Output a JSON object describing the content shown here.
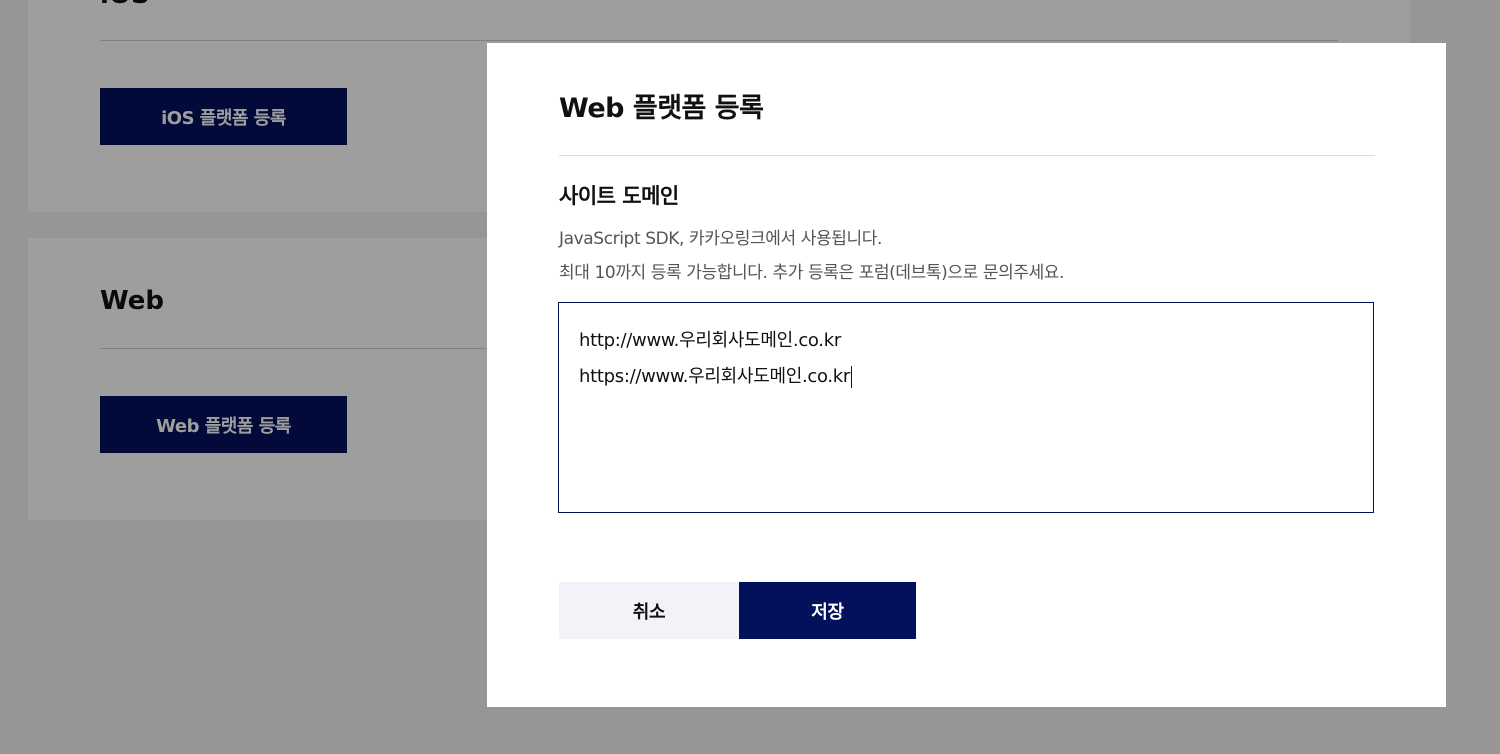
{
  "background": {
    "ios_section": {
      "title": "iOS",
      "register_button": "iOS 플랫폼 등록"
    },
    "web_section": {
      "title": "Web",
      "register_button": "Web 플랫폼 등록"
    }
  },
  "modal": {
    "title": "Web 플랫폼 등록",
    "field_label": "사이트 도메인",
    "description_lines": [
      "JavaScript SDK, 카카오링크에서 사용됩니다.",
      "최대 10까지 등록 가능합니다. 추가 등록은 포럼(데브톡)으로 문의주세요."
    ],
    "domains": [
      "http://www.우리회사도메인.co.kr",
      "https://www.우리회사도메인.co.kr"
    ],
    "cancel_label": "취소",
    "save_label": "저장"
  },
  "colors": {
    "primary": "#03115c",
    "cancel_bg": "#f1f3f8",
    "overlay": "rgba(0,0,0,0.38)"
  }
}
